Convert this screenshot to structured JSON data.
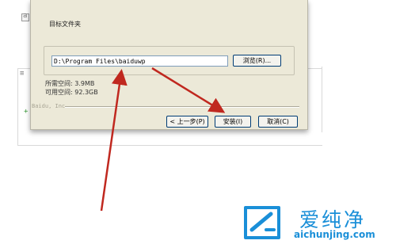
{
  "dialog": {
    "group_label": "目标文件夹",
    "install_path": "D:\\Program Files\\baiduwp",
    "browse_label": "浏览(R)...",
    "space_required": "所需空间: 3.9MB",
    "space_available": "可用空间: 92.3GB",
    "branding": "Baidu, Inc",
    "back_label": "< 上一步(P)",
    "install_label": "安装(I)",
    "cancel_label": "取消(C)"
  },
  "watermark": {
    "title": "爱纯净",
    "url": "aichunjing.com",
    "color": "#1a8fd8"
  },
  "annotation": {
    "arrow_color": "#c0281f",
    "arrow_count": 2
  },
  "background_page": {
    "marks": [
      "a",
      "≡",
      "+"
    ]
  }
}
